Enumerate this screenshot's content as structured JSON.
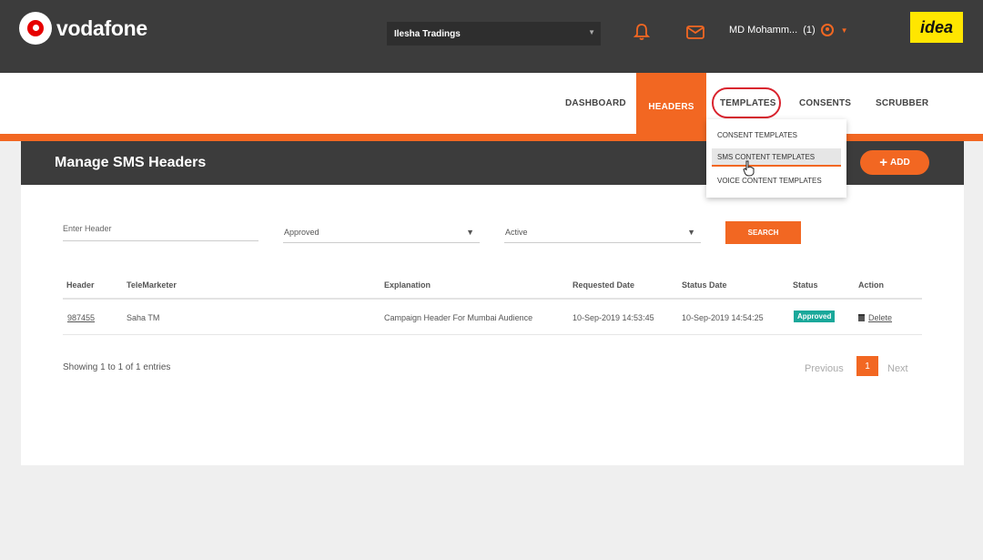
{
  "brand": {
    "name": "vodafone",
    "partner": "idea"
  },
  "header": {
    "company": "Ilesha Tradings",
    "user_name": "MD Mohamm...",
    "user_count": "(1)"
  },
  "nav": {
    "dashboard": "DASHBOARD",
    "headers": "HEADERS",
    "templates": "TEMPLATES",
    "consents": "CONSENTS",
    "scrubber": "SCRUBBER"
  },
  "templates_menu": [
    "CONSENT TEMPLATES",
    "SMS CONTENT TEMPLATES",
    "VOICE CONTENT TEMPLATES"
  ],
  "page": {
    "title": "Manage SMS Headers",
    "add_label": "ADD"
  },
  "filters": {
    "header_placeholder": "Enter Header",
    "status_value": "Approved",
    "activity_value": "Active",
    "search_label": "SEARCH"
  },
  "table": {
    "columns": [
      "Header",
      "TeleMarketer",
      "Explanation",
      "Requested Date",
      "Status Date",
      "Status",
      "Action"
    ],
    "rows": [
      {
        "header": "987455",
        "telemarketer": "Saha TM",
        "explanation": "Campaign Header For Mumbai Audience",
        "requested_date": "10-Sep-2019 14:53:45",
        "status_date": "10-Sep-2019 14:54:25",
        "status": "Approved",
        "action": "Delete"
      }
    ]
  },
  "pagination": {
    "summary": "Showing 1 to 1 of 1 entries",
    "previous": "Previous",
    "page": "1",
    "next": "Next"
  },
  "colors": {
    "accent": "#f26722",
    "topbar": "#3c3c3c",
    "status_approved": "#1aa89a",
    "highlight_circle": "#d9232e"
  }
}
